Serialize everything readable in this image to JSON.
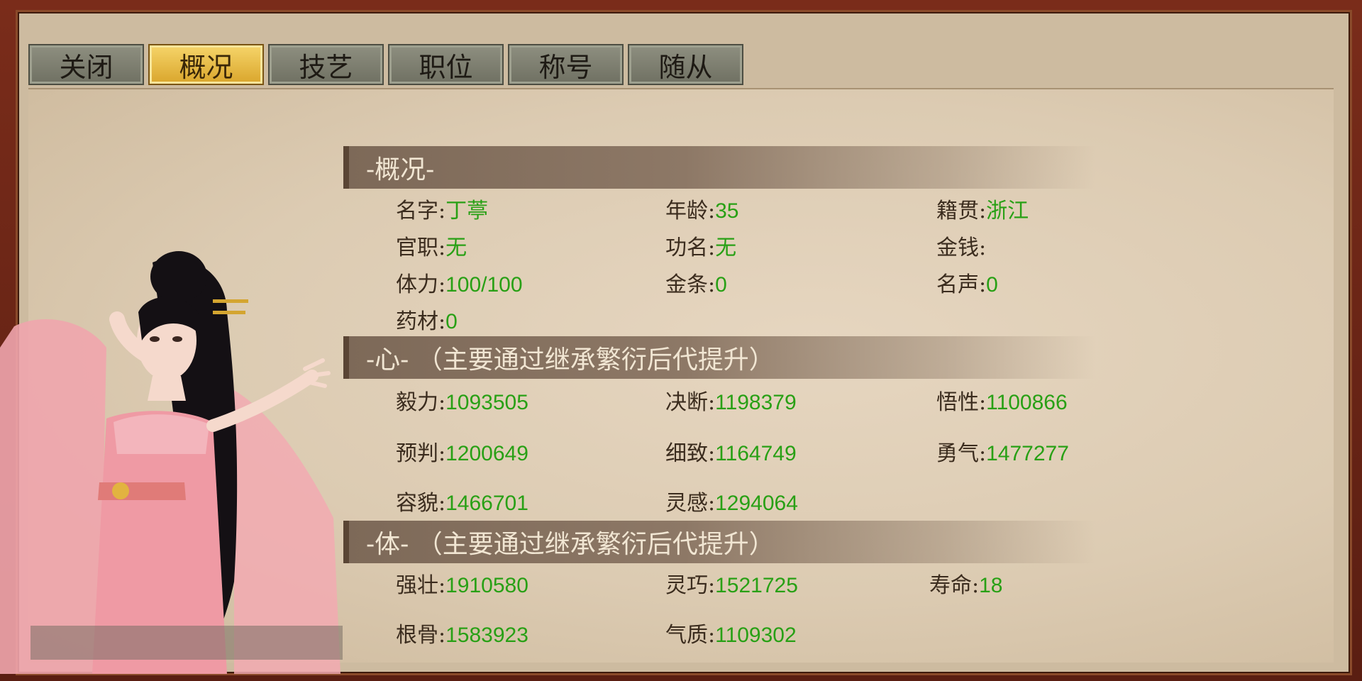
{
  "tabs": [
    {
      "label": "关闭",
      "active": false
    },
    {
      "label": "概况",
      "active": true
    },
    {
      "label": "技艺",
      "active": false
    },
    {
      "label": "职位",
      "active": false
    },
    {
      "label": "称号",
      "active": false
    },
    {
      "label": "随从",
      "active": false
    }
  ],
  "overview": {
    "header": "-概况-",
    "name": {
      "label": "名字:",
      "value": "丁葶"
    },
    "age": {
      "label": "年龄:",
      "value": "35"
    },
    "hometown": {
      "label": "籍贯:",
      "value": "浙江"
    },
    "office": {
      "label": "官职:",
      "value": "无"
    },
    "rank": {
      "label": "功名:",
      "value": "无"
    },
    "money": {
      "label": "金钱:",
      "value": ""
    },
    "stamina": {
      "label": "体力:",
      "value": "100/100"
    },
    "gold_bars": {
      "label": "金条:",
      "value": "0"
    },
    "reputation": {
      "label": "名声:",
      "value": "0"
    },
    "herbs": {
      "label": "药材:",
      "value": "0"
    }
  },
  "mind": {
    "header": "-心- （主要通过继承繁衍后代提升）",
    "perseverance": {
      "label": "毅力:",
      "value": "1093505"
    },
    "decisiveness": {
      "label": "决断:",
      "value": "1198379"
    },
    "insight": {
      "label": "悟性:",
      "value": "1100866"
    },
    "prediction": {
      "label": "预判:",
      "value": "1200649"
    },
    "meticulousness": {
      "label": "细致:",
      "value": "1164749"
    },
    "courage": {
      "label": "勇气:",
      "value": "1477277"
    },
    "appearance": {
      "label": "容貌:",
      "value": "1466701"
    },
    "inspiration": {
      "label": "灵感:",
      "value": "1294064"
    }
  },
  "body": {
    "header": "-体- （主要通过继承繁衍后代提升）",
    "strength": {
      "label": "强壮:",
      "value": "1910580"
    },
    "dexterity": {
      "label": "灵巧:",
      "value": "1521725"
    },
    "lifespan": {
      "label": "寿命:",
      "value": "18"
    },
    "constitution": {
      "label": "根骨:",
      "value": "1583923"
    },
    "temperament": {
      "label": "气质:",
      "value": "1109302"
    }
  },
  "colors": {
    "value_green": "#28a015",
    "label_brown": "#3b2c1e",
    "tab_active": "#e8bb44"
  }
}
